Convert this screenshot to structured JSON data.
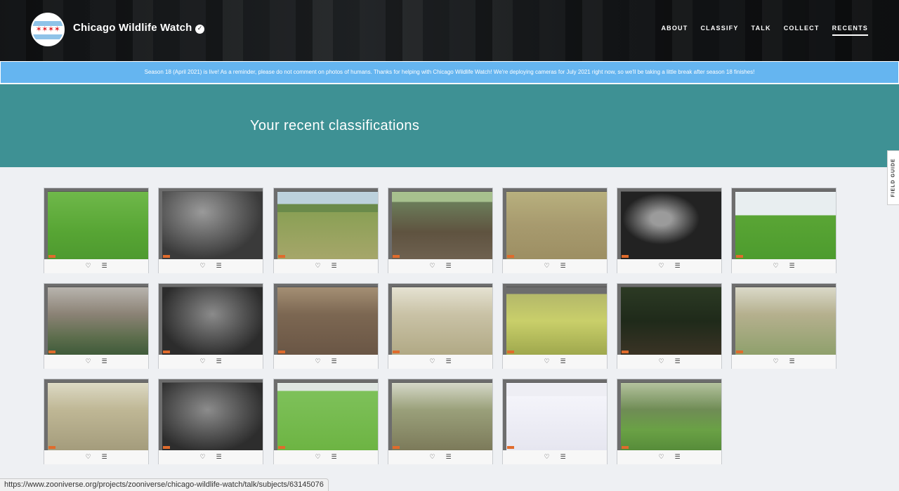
{
  "header": {
    "title": "Chicago Wildlife Watch",
    "nav": [
      "ABOUT",
      "CLASSIFY",
      "TALK",
      "COLLECT",
      "RECENTS"
    ],
    "active_nav": "RECENTS"
  },
  "announcement": "Season 18 (April 2021) is live! As a reminder, please do not comment on photos of humans. Thanks for helping with Chicago Wildlife Watch! We're deploying cameras for July 2021 right now, so we'll be taking a little break after season 18 finishes!",
  "hero": {
    "title": "Your recent classifications"
  },
  "field_guide": "FIELD GUIDE",
  "status_url": "https://www.zooniverse.org/projects/zooniverse/chicago-wildlife-watch/talk/subjects/63145076",
  "colors": {
    "hero": "#3e9194",
    "announcement": "#65b5f0"
  },
  "subjects": [
    {
      "scene": "green lawn"
    },
    {
      "scene": "night infrared woods"
    },
    {
      "scene": "grass and trees"
    },
    {
      "scene": "tree trunk with shadows"
    },
    {
      "scene": "hazy field"
    },
    {
      "scene": "night tree with deer"
    },
    {
      "scene": "park with person and dog"
    },
    {
      "scene": "misty woodland"
    },
    {
      "scene": "night infrared branches"
    },
    {
      "scene": "dirt path shadows"
    },
    {
      "scene": "sunny brush"
    },
    {
      "scene": "bright grass under fence"
    },
    {
      "scene": "dark forest"
    },
    {
      "scene": "sunlit brush"
    },
    {
      "scene": "leaf litter with log"
    },
    {
      "scene": "night infrared branches"
    },
    {
      "scene": "green lawn with trees"
    },
    {
      "scene": "woodland understory"
    },
    {
      "scene": "snowy woods"
    },
    {
      "scene": "green forest floor"
    }
  ]
}
